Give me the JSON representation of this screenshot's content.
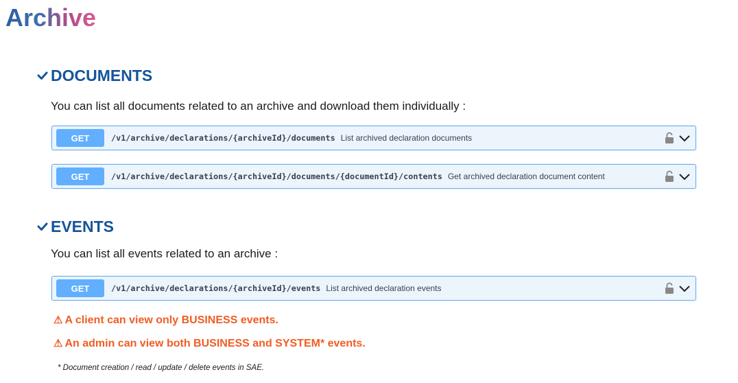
{
  "page": {
    "title": "Archive"
  },
  "sections": {
    "documents": {
      "heading": "DOCUMENTS",
      "description": "You can list all documents related to an archive and download them individually :",
      "endpoints": [
        {
          "method": "GET",
          "path": "/v1/archive/declarations/{archiveId}/documents",
          "summary": "List archived declaration documents"
        },
        {
          "method": "GET",
          "path": "/v1/archive/declarations/{archiveId}/documents/{documentId}/contents",
          "summary": "Get archived declaration document content"
        }
      ]
    },
    "events": {
      "heading": "EVENTS",
      "description": "You can list all events related to an archive :",
      "endpoints": [
        {
          "method": "GET",
          "path": "/v1/archive/declarations/{archiveId}/events",
          "summary": "List archived declaration events"
        }
      ],
      "warnings": [
        "A client can view only BUSINESS events.",
        "An admin can view both BUSINESS and SYSTEM* events."
      ],
      "footnote": "* Document creation / read / update / delete events in SAE."
    }
  },
  "icons": {
    "section_toggle": "chevron-check-icon",
    "lock": "lock-icon",
    "expand": "chevron-down-icon",
    "warning": "warning-triangle-icon"
  },
  "colors": {
    "get_method": "#61affe",
    "endpoint_bg": "#ecf4fc",
    "heading": "#15559a",
    "warning": "#f05d23"
  }
}
